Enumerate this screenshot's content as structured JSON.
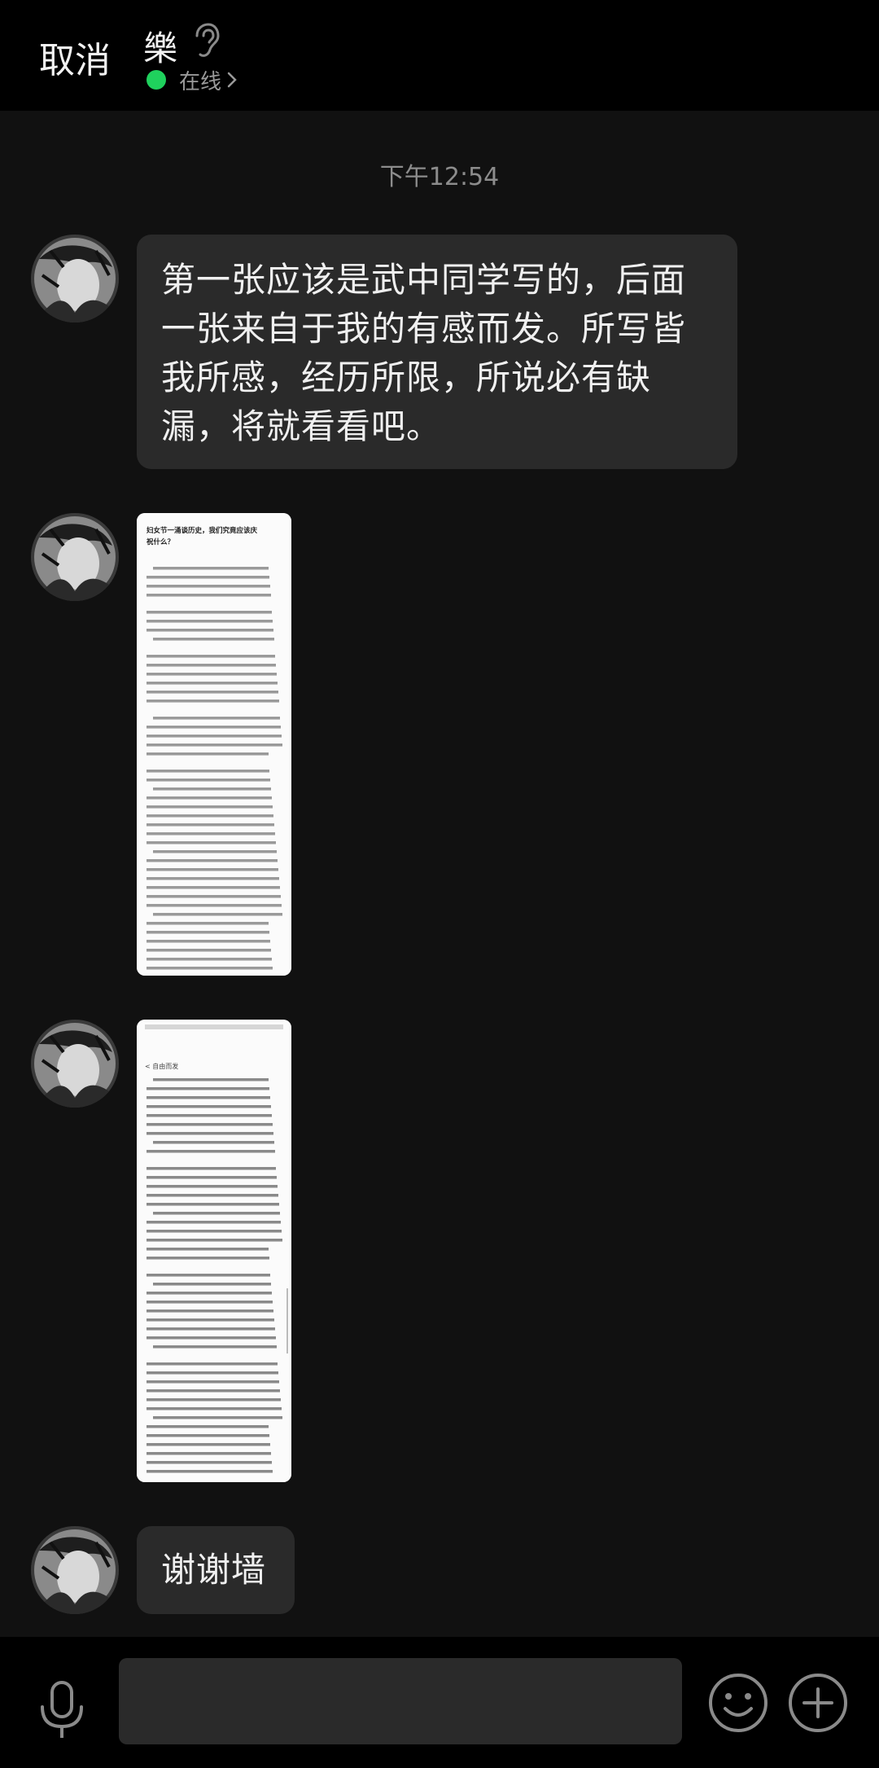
{
  "header": {
    "cancel_label": "取消",
    "contact_name": "樂",
    "status_text": "在线",
    "status_color": "#1fd15d"
  },
  "chat": {
    "timestamp": "下午12:54",
    "messages": [
      {
        "type": "text",
        "line1": "第一张应该是武中同学写的，后面",
        "line2": "一张来自于我的有感而发。所写皆",
        "line3": "我所感，经历所限，所说必有缺",
        "line4": "漏，将就看看吧。"
      },
      {
        "type": "image",
        "thumb_title_1": "妇女节一涌谈历史，我们究竟应该庆",
        "thumb_title_2": "祝什么？"
      },
      {
        "type": "image",
        "thumb_heading": "<  自由而发"
      },
      {
        "type": "text",
        "text": "谢谢墙"
      }
    ]
  },
  "icons": {
    "ear": "ear-icon",
    "mic": "microphone-icon",
    "emoji": "smiley-icon",
    "plus": "plus-icon"
  }
}
